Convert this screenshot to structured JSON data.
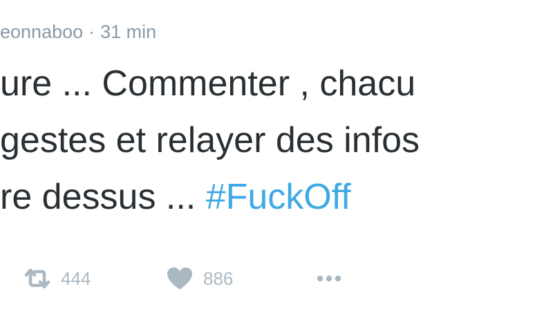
{
  "tweet": {
    "handle": "eonnaboo",
    "separator": "·",
    "timestamp": "31 min",
    "text_lines": [
      "ure ... Commenter , chacu",
      "gestes et relayer des infos"
    ],
    "last_line_text": "re dessus ... ",
    "hashtag": "#FuckOff"
  },
  "actions": {
    "retweet_count": "444",
    "like_count": "886",
    "retweet_icon": "retweet-icon",
    "like_icon": "heart-icon",
    "more_icon": "more-icon"
  },
  "colors": {
    "text": "#292f33",
    "meta": "#8899a6",
    "hashtag": "#3ea9e5",
    "icons": "#aab8c2"
  }
}
